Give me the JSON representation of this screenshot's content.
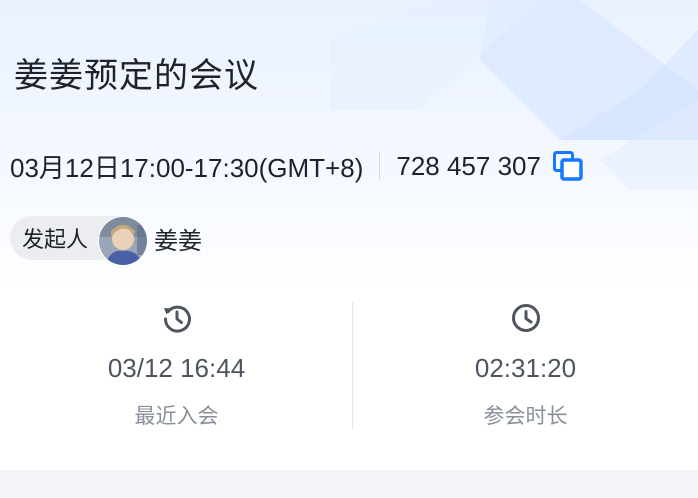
{
  "meeting": {
    "title": "姜姜预定的会议",
    "time_range": "03月12日17:00-17:30(GMT+8)",
    "meeting_id": "728 457 307"
  },
  "host": {
    "chip_label": "发起人",
    "name": "姜姜"
  },
  "stats": {
    "last_join": {
      "value": "03/12 16:44",
      "label": "最近入会",
      "icon": "history-clock-icon"
    },
    "duration": {
      "value": "02:31:20",
      "label": "参会时长",
      "icon": "clock-icon"
    }
  },
  "colors": {
    "accent": "#1677ff",
    "text_primary": "#1f2329",
    "text_secondary": "#4e5561",
    "text_muted": "#8a9099",
    "chip_bg": "#ebedf0"
  }
}
